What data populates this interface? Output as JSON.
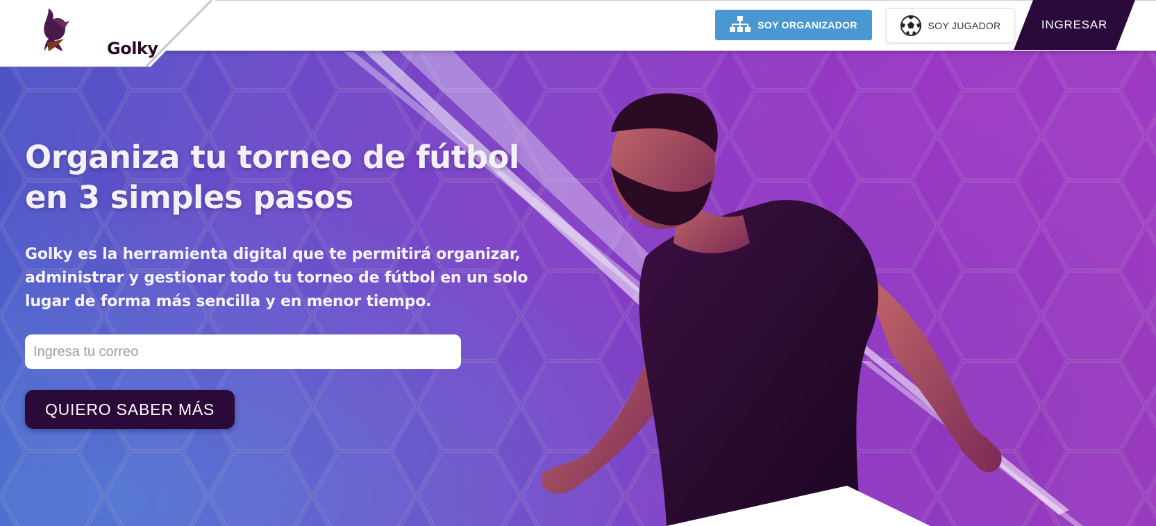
{
  "header": {
    "brand": "Golky",
    "buttons": {
      "organizer_label": "SOY ORGANIZADOR",
      "player_label": "SOY JUGADOR",
      "login_label": "INGRESAR"
    }
  },
  "hero": {
    "title_line1": "Organiza tu torneo de fútbol",
    "title_line2": "en 3 simples pasos",
    "subtitle_line1": "Golky es la herramienta digital que te permitirá organizar,",
    "subtitle_line2": "administrar y gestionar todo tu torneo de fútbol en un solo",
    "subtitle_line3": "lugar de forma más sencilla y en menor tiempo.",
    "email_placeholder": "Ingresa tu correo",
    "cta_label": "QUIERO SABER MÁS"
  },
  "icons": {
    "organizer": "org-chart-icon",
    "player": "soccer-ball-icon",
    "logo": "bird-logo-icon"
  },
  "colors": {
    "organizer_button": "#4b97d1",
    "login_button": "#2a0a3a",
    "cta_button": "#2b0a3a"
  }
}
